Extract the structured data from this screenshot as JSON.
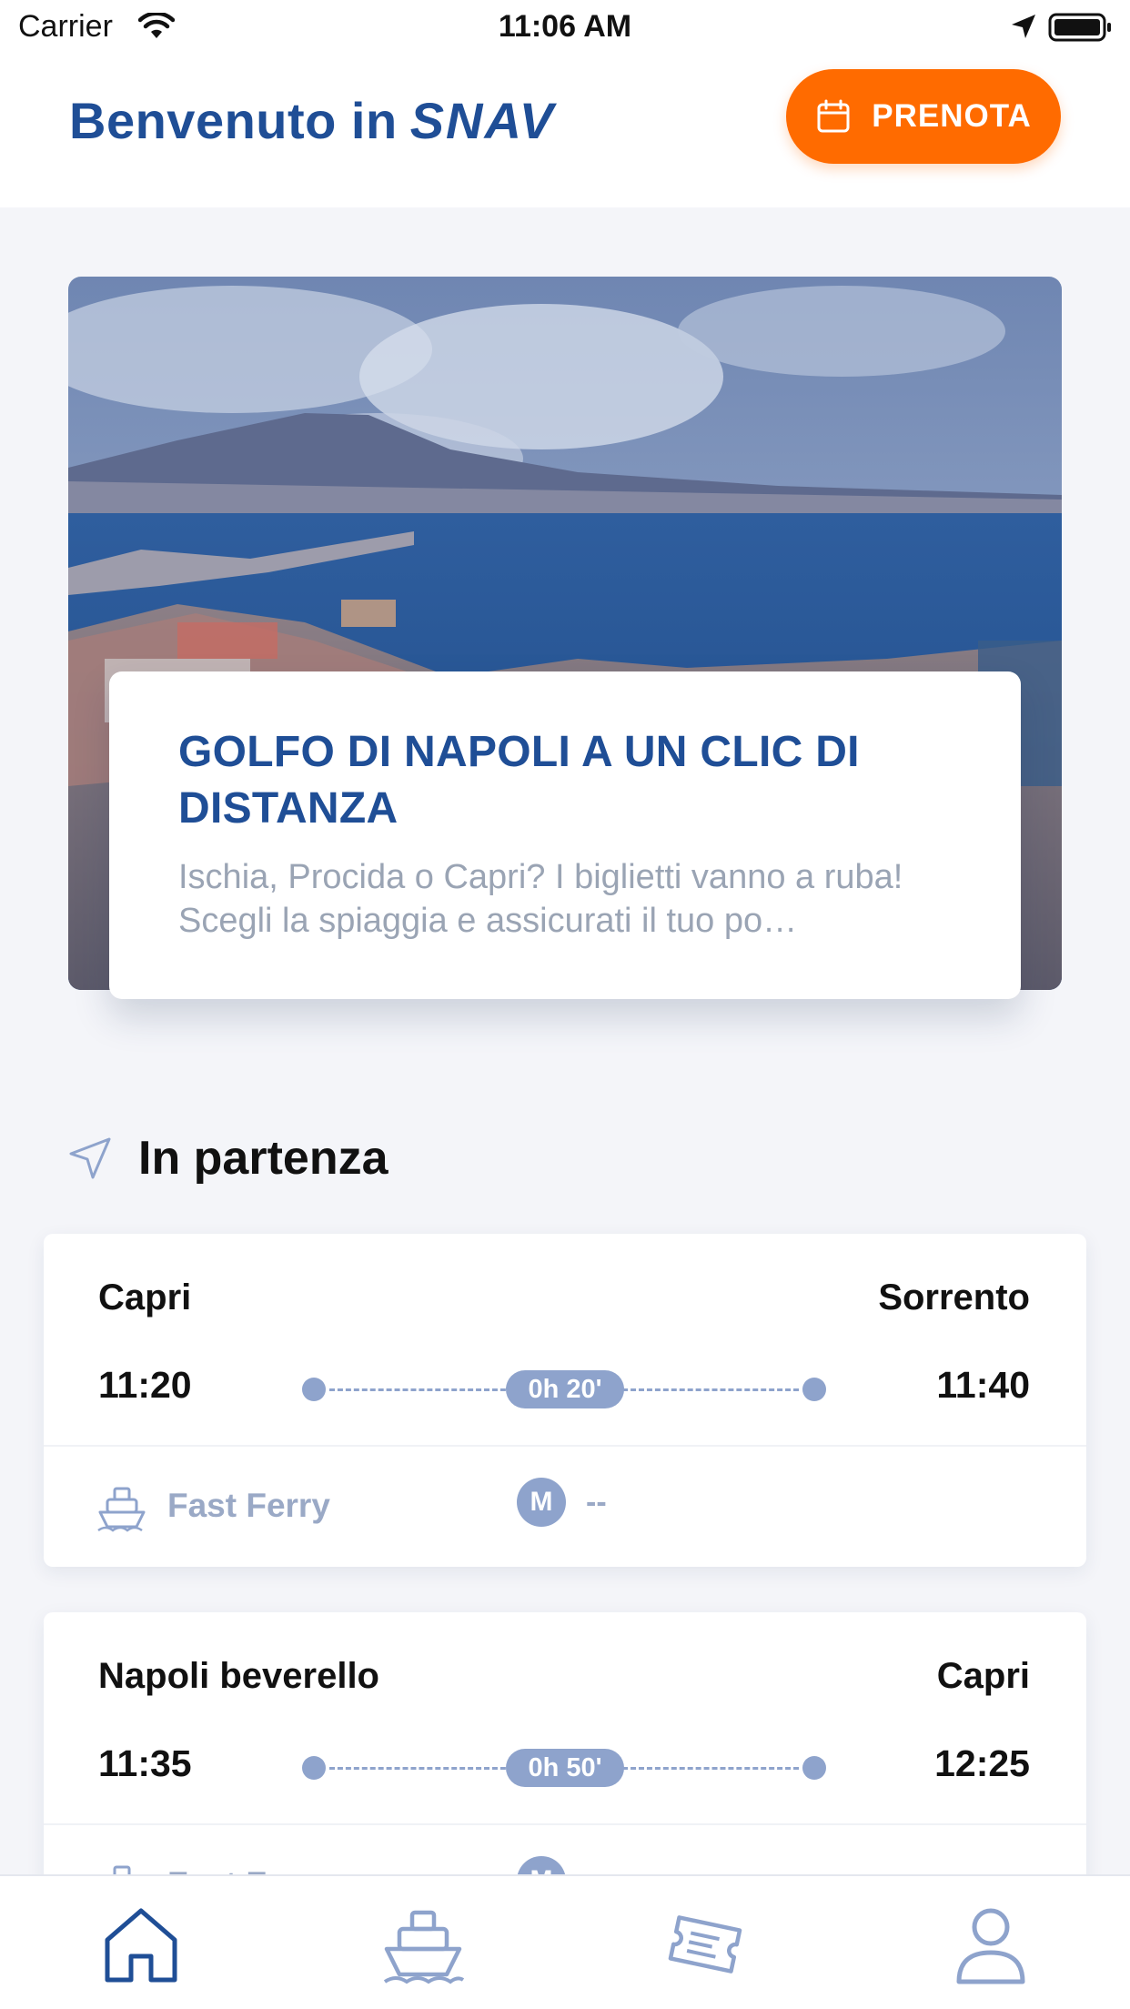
{
  "status_bar": {
    "carrier": "Carrier",
    "time": "11:06 AM"
  },
  "header": {
    "welcome": "Benvenuto in",
    "brand": "SNAV",
    "book_label": "PRENOTA",
    "icons": [
      "calendar-icon"
    ]
  },
  "hero": {
    "title": "GOLFO DI NAPOLI A UN CLIC DI DISTANZA",
    "description": "Ischia, Procida o Capri? I biglietti vanno a ruba! Scegli la spiaggia e assicurati il tuo po…"
  },
  "departures": {
    "title": "In partenza",
    "items": [
      {
        "from": "Capri",
        "to": "Sorrento",
        "dep_time": "11:20",
        "arr_time": "11:40",
        "duration": "0h 20'",
        "vessel_type": "Fast Ferry",
        "badge": "M",
        "badge_value": "--"
      },
      {
        "from": "Napoli beverello",
        "to": "Capri",
        "dep_time": "11:35",
        "arr_time": "12:25",
        "duration": "0h 50'",
        "vessel_type": "Fast Ferry",
        "badge": "M",
        "badge_value": "--"
      }
    ]
  },
  "tabbar": {
    "tabs": [
      "home-icon",
      "ship-icon",
      "tickets-icon",
      "profile-icon"
    ],
    "active": "home-icon"
  },
  "colors": {
    "brand_blue": "#1f4e96",
    "accent_orange": "#ff6b00",
    "muted_blue": "#8ea3cc",
    "muted_text": "#9aa4b4"
  }
}
